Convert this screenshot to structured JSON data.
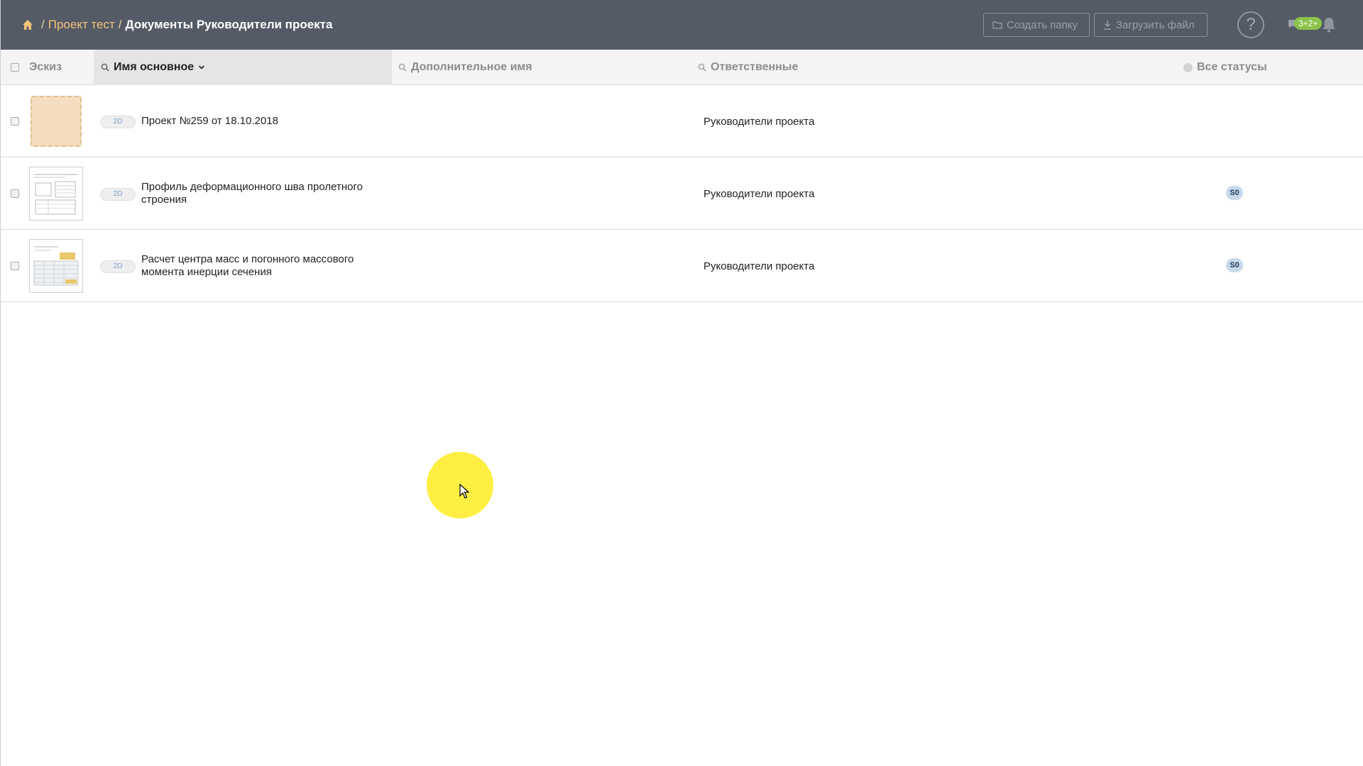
{
  "topbar": {
    "breadcrumb": {
      "home_icon": "home-icon",
      "separator": "/",
      "items": [
        "Проект тест"
      ],
      "current": "Документы Руководители проекта"
    },
    "create_folder_label": "Создать папку",
    "upload_file_label": "Загрузить файл",
    "help_label": "?",
    "notifications_badge": "3+2+",
    "colors": {
      "background": "#555b66",
      "link": "#f1c27a",
      "badge": "#8bc34a"
    }
  },
  "table": {
    "columns": {
      "sketch": "Эскиз",
      "name": "Имя основное",
      "extra_name": "Дополнительное имя",
      "responsible": "Ответственные",
      "status": "Все статусы"
    },
    "rows": [
      {
        "thumb": "folder",
        "tag": "2D",
        "name": "Проект №259 от 18.10.2018",
        "responsible": "Руководители проекта",
        "status": ""
      },
      {
        "thumb": "document",
        "tag": "2D",
        "name": "Профиль деформационного шва пролетного строения",
        "responsible": "Руководители проекта",
        "status": "S0"
      },
      {
        "thumb": "spreadsheet",
        "tag": "2D",
        "name": "Расчет центра масс и погонного массового момента инерции сечения",
        "responsible": "Руководители проекта",
        "status": "S0"
      }
    ]
  }
}
